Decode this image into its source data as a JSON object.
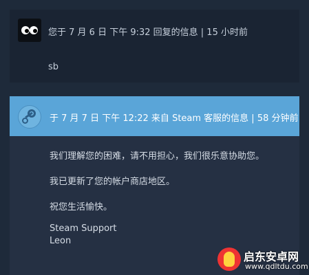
{
  "message1": {
    "meta": "您于 7 月 6 日 下午 9:32 回复的信息 | 15 小时前",
    "body": "sb"
  },
  "message2": {
    "meta": "于 7 月 7 日 下午 12:22 来自 Steam 客服的信息 | 58 分钟前",
    "lines": [
      "我们理解您的困难，请不用担心，我们很乐意协助您。",
      "我已更新了您的帐户商店地区。",
      "祝您生活愉快。",
      "Steam Support",
      "Leon"
    ]
  },
  "watermark": {
    "title": "启东安卓网",
    "url": "www.qdltdu.com"
  },
  "colors": {
    "header_blue": "#5aa5d8",
    "background": "#1e2a3a"
  }
}
